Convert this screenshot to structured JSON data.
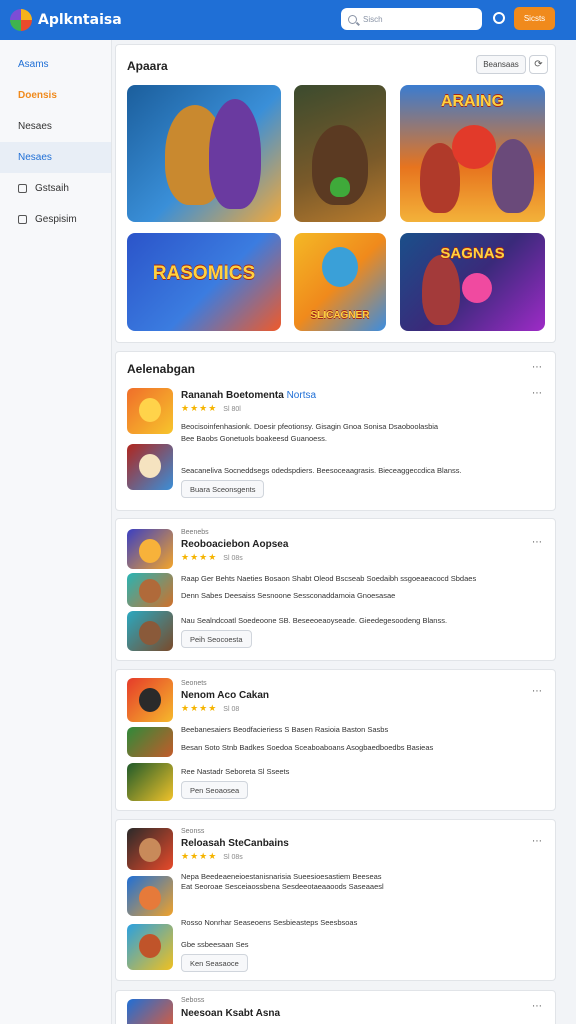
{
  "header": {
    "title": "Aplkntaisa",
    "search_placeholder": "Sisch",
    "cta_label": "Sicsts"
  },
  "sidebar": {
    "items": [
      {
        "label": "Asams",
        "style": "blue",
        "icon": ""
      },
      {
        "label": "Doensis",
        "style": "orange",
        "icon": ""
      },
      {
        "label": "Nesaes",
        "style": "plain",
        "icon": ""
      },
      {
        "label": "Nesaes",
        "style": "active",
        "icon": ""
      },
      {
        "label": "Gstsaih",
        "style": "plain",
        "icon": "box-icon"
      },
      {
        "label": "Gespisim",
        "style": "plain",
        "icon": "lock-icon"
      }
    ]
  },
  "featured": {
    "title": "Apaara",
    "filter_label": "Beansaas",
    "tiles": [
      {
        "label": "",
        "colors": [
          "#1b5e9c",
          "#f3a93a"
        ]
      },
      {
        "label": "",
        "colors": [
          "#3b4b2e",
          "#b87b2d"
        ]
      },
      {
        "label": "ARAING",
        "colors": [
          "#e7741e",
          "#3b7cd0"
        ]
      },
      {
        "label": "RASOMICS",
        "colors": [
          "#2b54c9",
          "#ef5a2a"
        ]
      },
      {
        "label": "SLICAGNER",
        "colors": [
          "#f4b826",
          "#3b8de0"
        ]
      },
      {
        "label": "SAGNAS",
        "colors": [
          "#1a4f8a",
          "#9e2bc7"
        ]
      }
    ]
  },
  "sections": [
    {
      "heading": "Aelenabgan",
      "caption": "",
      "title": "Rananah Boetomenta",
      "title_accent": "Nortsa",
      "stars": "★★★★",
      "meta": "Sl 80l",
      "lines": [
        "Beocisoinfenhasionk. Doesir pfeotionsy. Gisagin Gnoa Sonisa Dsaoboolasbia",
        "Bee Baobs Gonetuols boakeesd Guanoess.",
        "Seacaneliva Socneddsegs odedspdiers. Beesoceaagrasis. Bieceaggeccdica Blanss."
      ],
      "button": "Buara Sceonsgents",
      "thumbs": [
        [
          "#f06e2a",
          "#f7c52c"
        ],
        [
          "#b0261e",
          "#3a8fd8"
        ]
      ]
    },
    {
      "heading": "",
      "caption": "Beenebs",
      "title": "Reoboaciebon Aopsea",
      "title_accent": "",
      "stars": "★★★★",
      "meta": "Sl 08s",
      "lines": [
        "Raap Ger Behts Naeties Bosaon Shabt Oleod Bscseab Soedaibh ssgoeaeacocd Sbdaes",
        "Denn Sabes Deesaiss Sesnoone Sessconaddamoia Gnoesasae",
        "Nau Sealndcoatl Soedeoone SB. Beseeoeaoyseade. Gieedegesoodeng Blanss."
      ],
      "button": "Peih Seocoesta",
      "thumbs": [
        [
          "#3a3fc2",
          "#f4a52a"
        ],
        [
          "#28b4b4",
          "#d0702a"
        ],
        [
          "#2aa8c0",
          "#7a4a2a"
        ]
      ]
    },
    {
      "heading": "",
      "caption": "Seonets",
      "title": "Nenom Aco Cakan",
      "title_accent": "",
      "stars": "★★★★",
      "meta": "Sl 08",
      "lines": [
        "Beebanesaiers Beodfacieriess S Basen Rasioia Baston Sasbs",
        "Besan Soto Stnb Badkes Soedoa Sceaboaboans Asogbaedboedbs Basieas",
        "Ree Nastadr Seboreta Sl Sseets"
      ],
      "button": "Pen Seoaosea",
      "thumbs": [
        [
          "#e53b2a",
          "#f6b92c"
        ],
        [
          "#2f8a3a",
          "#c45b2a"
        ],
        [
          "#1f5a2a",
          "#f0c22a"
        ]
      ]
    },
    {
      "heading": "",
      "caption": "Seonss",
      "title": "Reloasah SteCanbains",
      "title_accent": "",
      "stars": "★★★★",
      "meta": "Sl 08s",
      "lines": [
        "Nepa Beedeaeneioestanisnarisia Sueesioesastiem Beeseas",
        "Eat Seoroae Sesceiaossbena Sesdeeotaeaaoods Saseaaesl",
        "Rosso Nonrhar Seaseoens Sesbieasteps Seesbsoas",
        "Gbe ssbeesaan Ses"
      ],
      "button": "Ken Seasaoce",
      "thumbs": [
        [
          "#2a2a2a",
          "#e84a2a"
        ],
        [
          "#1f6fd6",
          "#f0a22a"
        ],
        [
          "#2aa0e0",
          "#f0c020"
        ]
      ]
    },
    {
      "heading": "",
      "caption": "Seboss",
      "title": "Neesoan Ksabt Asna",
      "title_accent": "",
      "stars": "★★★★",
      "meta": "",
      "lines": [],
      "button": "",
      "thumbs": [
        [
          "#1f6fd6",
          "#f05a2a"
        ]
      ]
    }
  ]
}
